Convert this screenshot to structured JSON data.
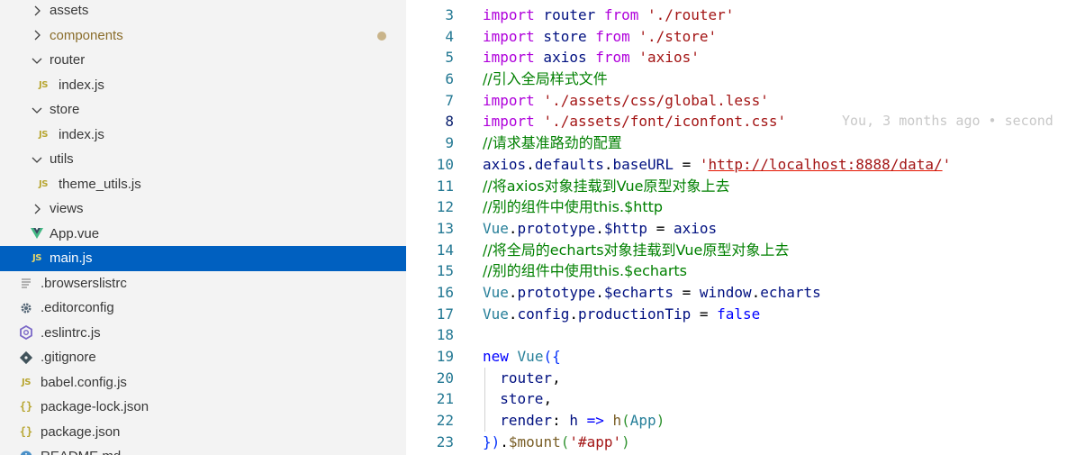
{
  "explorer": {
    "items": [
      {
        "label": "assets",
        "kind": "folder",
        "state": "collapsed",
        "depth": 1,
        "icon": "chevron-right-icon"
      },
      {
        "label": "components",
        "kind": "folder",
        "state": "collapsed",
        "depth": 1,
        "icon": "chevron-right-icon",
        "modified": true
      },
      {
        "label": "router",
        "kind": "folder",
        "state": "expanded",
        "depth": 1,
        "icon": "chevron-down-icon"
      },
      {
        "label": "index.js",
        "kind": "js",
        "depth": 2,
        "icon": "js-file-icon",
        "icon_text": "JS"
      },
      {
        "label": "store",
        "kind": "folder",
        "state": "expanded",
        "depth": 1,
        "icon": "chevron-down-icon"
      },
      {
        "label": "index.js",
        "kind": "js",
        "depth": 2,
        "icon": "js-file-icon",
        "icon_text": "JS"
      },
      {
        "label": "utils",
        "kind": "folder",
        "state": "expanded",
        "depth": 1,
        "icon": "chevron-down-icon"
      },
      {
        "label": "theme_utils.js",
        "kind": "js",
        "depth": 2,
        "icon": "js-file-icon",
        "icon_text": "JS"
      },
      {
        "label": "views",
        "kind": "folder",
        "state": "collapsed",
        "depth": 1,
        "icon": "chevron-right-icon"
      },
      {
        "label": "App.vue",
        "kind": "vue",
        "depth": 1,
        "icon": "vue-file-icon"
      },
      {
        "label": "main.js",
        "kind": "js",
        "depth": 1,
        "icon": "js-file-icon",
        "icon_text": "JS",
        "selected": true
      },
      {
        "label": ".browserslistrc",
        "kind": "text",
        "depth": 0,
        "icon": "text-file-icon"
      },
      {
        "label": ".editorconfig",
        "kind": "config",
        "depth": 0,
        "icon": "gear-icon"
      },
      {
        "label": ".eslintrc.js",
        "kind": "eslint",
        "depth": 0,
        "icon": "eslint-icon"
      },
      {
        "label": ".gitignore",
        "kind": "git",
        "depth": 0,
        "icon": "git-icon"
      },
      {
        "label": "babel.config.js",
        "kind": "js",
        "depth": 0,
        "icon": "js-file-icon",
        "icon_text": "JS"
      },
      {
        "label": "package-lock.json",
        "kind": "json",
        "depth": 0,
        "icon": "json-file-icon",
        "icon_text": "{}"
      },
      {
        "label": "package.json",
        "kind": "json",
        "depth": 0,
        "icon": "json-file-icon",
        "icon_text": "{}"
      },
      {
        "label": "README.md",
        "kind": "info",
        "depth": 0,
        "icon": "info-icon"
      }
    ]
  },
  "editor": {
    "active_line": 8,
    "blame": "You, 3 months ago • second",
    "lines": [
      {
        "num": "3",
        "tokens": [
          {
            "t": "import",
            "c": "kw"
          },
          {
            "t": " router ",
            "c": "id"
          },
          {
            "t": "from",
            "c": "kw"
          },
          {
            "t": " ",
            "c": "plain"
          },
          {
            "t": "'./router'",
            "c": "str"
          }
        ]
      },
      {
        "num": "4",
        "tokens": [
          {
            "t": "import",
            "c": "kw"
          },
          {
            "t": " store ",
            "c": "id"
          },
          {
            "t": "from",
            "c": "kw"
          },
          {
            "t": " ",
            "c": "plain"
          },
          {
            "t": "'./store'",
            "c": "str"
          }
        ]
      },
      {
        "num": "5",
        "tokens": [
          {
            "t": "import",
            "c": "kw"
          },
          {
            "t": " axios ",
            "c": "id"
          },
          {
            "t": "from",
            "c": "kw"
          },
          {
            "t": " ",
            "c": "plain"
          },
          {
            "t": "'axios'",
            "c": "str"
          }
        ]
      },
      {
        "num": "6",
        "tokens": [
          {
            "t": "//引入全局样式文件",
            "c": "cm"
          }
        ]
      },
      {
        "num": "7",
        "tokens": [
          {
            "t": "import",
            "c": "kw"
          },
          {
            "t": " ",
            "c": "plain"
          },
          {
            "t": "'./assets/css/global.less'",
            "c": "str"
          }
        ]
      },
      {
        "num": "8",
        "tokens": [
          {
            "t": "import",
            "c": "kw"
          },
          {
            "t": " ",
            "c": "plain"
          },
          {
            "t": "'./assets/font/iconfont.css'",
            "c": "str"
          }
        ],
        "blame": true
      },
      {
        "num": "9",
        "tokens": [
          {
            "t": "//请求基准路劲的配置",
            "c": "cm"
          }
        ]
      },
      {
        "num": "10",
        "tokens": [
          {
            "t": "axios",
            "c": "id"
          },
          {
            "t": ".",
            "c": "plain"
          },
          {
            "t": "defaults",
            "c": "id"
          },
          {
            "t": ".",
            "c": "plain"
          },
          {
            "t": "baseURL",
            "c": "id"
          },
          {
            "t": " = ",
            "c": "plain"
          },
          {
            "t": "'",
            "c": "str"
          },
          {
            "t": "http://localhost:8888/data/",
            "c": "str url"
          },
          {
            "t": "'",
            "c": "str"
          }
        ]
      },
      {
        "num": "11",
        "tokens": [
          {
            "t": "//将axios对象挂载到Vue原型对象上去",
            "c": "cm"
          }
        ]
      },
      {
        "num": "12",
        "tokens": [
          {
            "t": "//别的组件中使用this.$http",
            "c": "cm"
          }
        ]
      },
      {
        "num": "13",
        "tokens": [
          {
            "t": "Vue",
            "c": "cls"
          },
          {
            "t": ".",
            "c": "plain"
          },
          {
            "t": "prototype",
            "c": "id"
          },
          {
            "t": ".",
            "c": "plain"
          },
          {
            "t": "$http",
            "c": "id"
          },
          {
            "t": " = ",
            "c": "plain"
          },
          {
            "t": "axios",
            "c": "id"
          }
        ]
      },
      {
        "num": "14",
        "tokens": [
          {
            "t": "//将全局的echarts对象挂载到Vue原型对象上去",
            "c": "cm"
          }
        ]
      },
      {
        "num": "15",
        "tokens": [
          {
            "t": "//别的组件中使用this.$echarts",
            "c": "cm"
          }
        ]
      },
      {
        "num": "16",
        "tokens": [
          {
            "t": "Vue",
            "c": "cls"
          },
          {
            "t": ".",
            "c": "plain"
          },
          {
            "t": "prototype",
            "c": "id"
          },
          {
            "t": ".",
            "c": "plain"
          },
          {
            "t": "$echarts",
            "c": "id"
          },
          {
            "t": " = ",
            "c": "plain"
          },
          {
            "t": "window",
            "c": "id"
          },
          {
            "t": ".",
            "c": "plain"
          },
          {
            "t": "echarts",
            "c": "id"
          }
        ]
      },
      {
        "num": "17",
        "tokens": [
          {
            "t": "Vue",
            "c": "cls"
          },
          {
            "t": ".",
            "c": "plain"
          },
          {
            "t": "config",
            "c": "id"
          },
          {
            "t": ".",
            "c": "plain"
          },
          {
            "t": "productionTip",
            "c": "id"
          },
          {
            "t": " = ",
            "c": "plain"
          },
          {
            "t": "false",
            "c": "kw2"
          }
        ]
      },
      {
        "num": "18",
        "tokens": []
      },
      {
        "num": "19",
        "tokens": [
          {
            "t": "new",
            "c": "kw2"
          },
          {
            "t": " ",
            "c": "plain"
          },
          {
            "t": "Vue",
            "c": "cls"
          },
          {
            "t": "({",
            "c": "br"
          }
        ]
      },
      {
        "num": "20",
        "tokens": [
          {
            "t": "  router",
            "c": "id"
          },
          {
            "t": ",",
            "c": "plain"
          }
        ],
        "guide": true
      },
      {
        "num": "21",
        "tokens": [
          {
            "t": "  store",
            "c": "id"
          },
          {
            "t": ",",
            "c": "plain"
          }
        ],
        "guide": true
      },
      {
        "num": "22",
        "tokens": [
          {
            "t": "  render",
            "c": "id"
          },
          {
            "t": ": ",
            "c": "plain"
          },
          {
            "t": "h",
            "c": "id"
          },
          {
            "t": " => ",
            "c": "kw2"
          },
          {
            "t": "h",
            "c": "fn"
          },
          {
            "t": "(",
            "c": "br2"
          },
          {
            "t": "App",
            "c": "cls"
          },
          {
            "t": ")",
            "c": "br2"
          }
        ],
        "guide": true
      },
      {
        "num": "23",
        "tokens": [
          {
            "t": "})",
            "c": "br"
          },
          {
            "t": ".",
            "c": "plain"
          },
          {
            "t": "$mount",
            "c": "fn"
          },
          {
            "t": "(",
            "c": "br2"
          },
          {
            "t": "'#app'",
            "c": "str"
          },
          {
            "t": ")",
            "c": "br2"
          }
        ]
      }
    ]
  },
  "colors": {
    "sidebar_bg": "#f3f3f3",
    "selection": "#0060c0",
    "keyword": "#af00db",
    "string": "#a31515",
    "comment": "#008000",
    "variable": "#001080",
    "type": "#267f99"
  }
}
